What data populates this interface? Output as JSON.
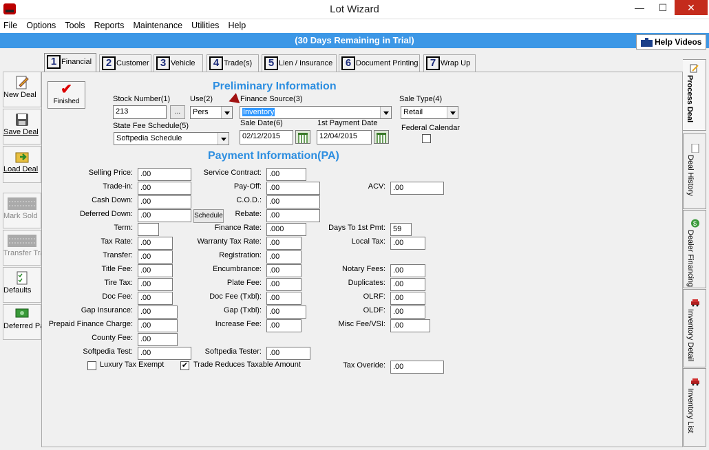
{
  "window": {
    "title": "Lot Wizard",
    "minimize": "—",
    "maximize": "☐",
    "close": "✕"
  },
  "menu": [
    "File",
    "Options",
    "Tools",
    "Reports",
    "Maintenance",
    "Utilities",
    "Help"
  ],
  "trial_text": "(30 Days Remaining in Trial)",
  "help_videos": "Help Videos",
  "left_buttons": [
    {
      "label": "New Deal",
      "icon": "new-deal-icon"
    },
    {
      "label": "Save Deal",
      "icon": "save-icon"
    },
    {
      "label": "Load Deal",
      "icon": "load-icon"
    },
    {
      "label": "Mark Sold",
      "icon": "mark-sold-icon"
    },
    {
      "label": "Transfer Trades",
      "icon": "transfer-icon"
    },
    {
      "label": "Defaults",
      "icon": "defaults-icon"
    },
    {
      "label": "Deferred Payments",
      "icon": "deferred-icon"
    }
  ],
  "tabs": [
    {
      "num": "1",
      "label": "Financial"
    },
    {
      "num": "2",
      "label": "Customer"
    },
    {
      "num": "3",
      "label": "Vehicle"
    },
    {
      "num": "4",
      "label": "Trade(s)"
    },
    {
      "num": "5",
      "label": "Lien / Insurance"
    },
    {
      "num": "6",
      "label": "Document Printing"
    },
    {
      "num": "7",
      "label": "Wrap Up"
    }
  ],
  "right_tabs": [
    "Process Deal",
    "Deal History",
    "Dealer Financing",
    "Inventory Detail",
    "Inventory List"
  ],
  "finished_label": "Finished",
  "preliminary": {
    "title": "Preliminary Information",
    "stock_number_label": "Stock Number(1)",
    "stock_number": "213",
    "browse": "...",
    "use_label": "Use(2)",
    "use_value": "Pers",
    "finance_source_label": "Finance Source(3)",
    "finance_source": "Inventory",
    "sale_type_label": "Sale Type(4)",
    "sale_type": "Retail",
    "state_fee_label": "State Fee Schedule(5)",
    "state_fee": "Softpedia Schedule",
    "sale_date_label": "Sale Date(6)",
    "sale_date": "02/12/2015",
    "first_payment_label": "1st Payment Date",
    "first_payment": "12/04/2015",
    "federal_calendar_label": "Federal Calendar"
  },
  "payment": {
    "title": "Payment Information(PA)",
    "col1": [
      {
        "label": "Selling Price:",
        "value": ".00"
      },
      {
        "label": "Trade-in:",
        "value": ".00"
      },
      {
        "label": "Cash Down:",
        "value": ".00"
      },
      {
        "label": "Deferred Down:",
        "value": ".00"
      },
      {
        "label": "Term:",
        "value": ""
      },
      {
        "label": "Tax Rate:",
        "value": ".00"
      },
      {
        "label": "Transfer:",
        "value": ".00"
      },
      {
        "label": "Title Fee:",
        "value": ".00"
      },
      {
        "label": "Tire Tax:",
        "value": ".00"
      },
      {
        "label": "Doc Fee:",
        "value": ".00"
      },
      {
        "label": "Gap Insurance:",
        "value": ".00"
      },
      {
        "label": "Prepaid Finance Charge:",
        "value": ".00"
      },
      {
        "label": "County Fee:",
        "value": ".00"
      },
      {
        "label": "Softpedia Test:",
        "value": ".00"
      }
    ],
    "schedule_btn": "Schedule",
    "col2": [
      {
        "label": "Service Contract:",
        "value": ".00"
      },
      {
        "label": "Pay-Off:",
        "value": ".00"
      },
      {
        "label": "C.O.D.:",
        "value": ".00"
      },
      {
        "label": "Rebate:",
        "value": ".00"
      },
      {
        "label": "Finance Rate:",
        "value": ".000"
      },
      {
        "label": "Warranty Tax Rate:",
        "value": ".00"
      },
      {
        "label": "Registration:",
        "value": ".00"
      },
      {
        "label": "Encumbrance:",
        "value": ".00"
      },
      {
        "label": "Plate Fee:",
        "value": ".00"
      },
      {
        "label": "Doc Fee (Txbl):",
        "value": ".00"
      },
      {
        "label": "Gap (Txbl):",
        "value": ".00"
      },
      {
        "label": "Increase Fee:",
        "value": ".00"
      },
      {
        "label": "Softpedia Tester:",
        "value": ".00"
      }
    ],
    "col3": [
      {
        "label": "ACV:",
        "value": ".00"
      },
      {
        "label": "Days To 1st Pmt:",
        "value": "59"
      },
      {
        "label": "Local Tax:",
        "value": ".00"
      },
      {
        "label": "Notary Fees:",
        "value": ".00"
      },
      {
        "label": "Duplicates:",
        "value": ".00"
      },
      {
        "label": "OLRF:",
        "value": ".00"
      },
      {
        "label": "OLDF:",
        "value": ".00"
      },
      {
        "label": "Misc Fee/VSI:",
        "value": ".00"
      },
      {
        "label": "Tax Overide:",
        "value": ".00"
      }
    ],
    "luxury_tax_label": "Luxury Tax Exempt",
    "luxury_tax_checked": false,
    "trade_reduces_label": "Trade Reduces Taxable Amount",
    "trade_reduces_checked": true
  },
  "colors": {
    "accent": "#2d8ee0",
    "trial_bar": "#3c97e6",
    "close": "#c42b1c"
  }
}
